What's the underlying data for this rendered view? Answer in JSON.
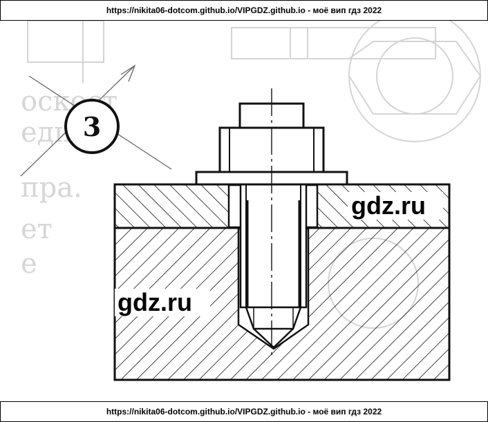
{
  "banner_top": "https://nikita06-dotcom.github.io/VIPGDZ.github.io  - моё вип гдз  2022",
  "banner_bottom": "https://nikita06-dotcom.github.io/VIPGDZ.github.io  - моё вип гдз  2022",
  "figure_number": "3",
  "watermark_top": "gdz.ru",
  "watermark_bottom": "gdz.ru",
  "colors": {
    "ink": "#111111",
    "ghost": "#d0d0d0",
    "paper": "#ffffff"
  }
}
